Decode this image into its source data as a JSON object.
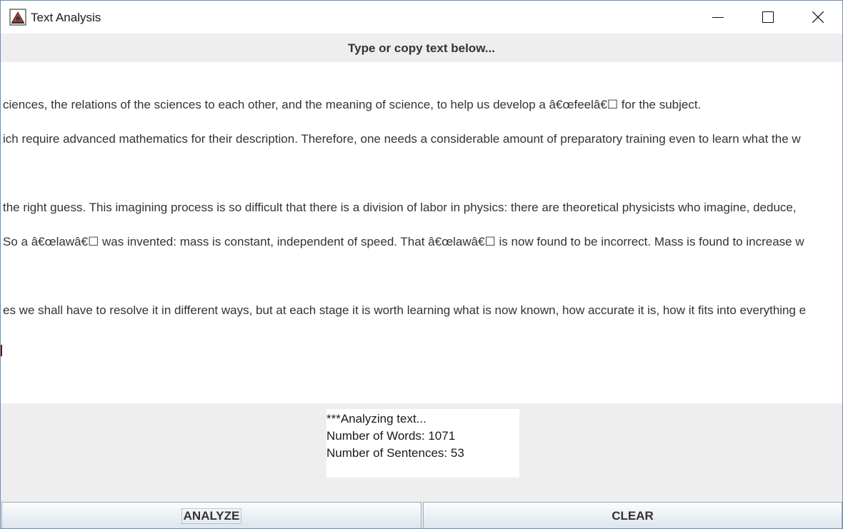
{
  "window": {
    "title": "Text Analysis",
    "icon": "java-app-icon"
  },
  "controls": {
    "minimize": "minimize-icon",
    "maximize": "maximize-icon",
    "close": "close-icon"
  },
  "header": {
    "label": "Type or copy text below..."
  },
  "text_area": {
    "lines": [
      "ciences, the relations of the sciences to each other, and the meaning of science, to help us develop a â€œfeelâ€☐ for the subject.",
      "ich require advanced mathematics for their description. Therefore, one needs a considerable amount of preparatory training even to learn what the w",
      "",
      "the right guess. This imagining process is so difficult that there is a division of labor in physics: there are theoretical physicists who imagine, deduce,",
      " So a â€œlawâ€☐ was invented: mass is constant, independent of speed. That â€œlawâ€☐ is now found to be incorrect. Mass is found to increase w",
      "",
      "es we shall have to resolve it in different ways, but at each stage it is worth learning what is now known, how accurate it is, how it fits into everything e"
    ]
  },
  "output": {
    "status": "***Analyzing text...",
    "words": "Number of Words: 1071",
    "sentences": "Number of Sentences: 53"
  },
  "buttons": {
    "analyze": "ANALYZE",
    "clear": "CLEAR"
  }
}
